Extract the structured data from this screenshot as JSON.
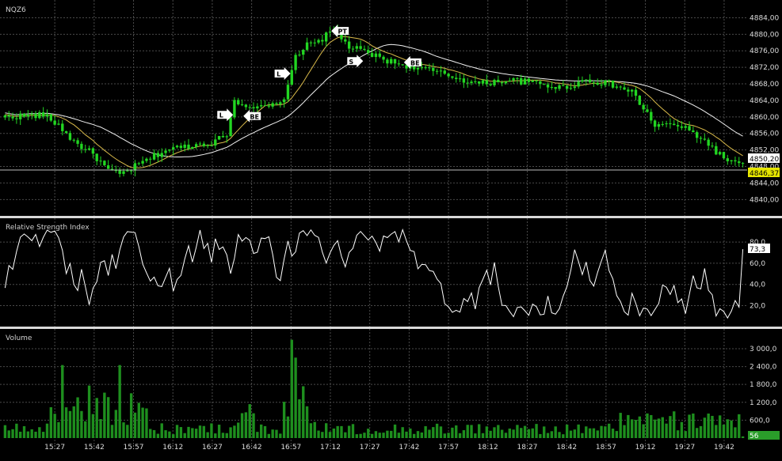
{
  "colors": {
    "background": "#000000",
    "grid": "#4a4a4a",
    "candle": "#22d622",
    "ma_fast": "#d8b94a",
    "ma_slow": "#f2f2f2",
    "rsi": "#ffffff",
    "volume": "#1e8f1e",
    "separator": "#d9d9d9",
    "price_tag_bg": "#ffffff",
    "last_tag_bg": "#e6e600"
  },
  "chart_data": [
    {
      "type": "candlestick",
      "title": "NQZ6",
      "x_labels": [
        "15:27",
        "15:42",
        "15:57",
        "16:12",
        "16:27",
        "16:42",
        "16:57",
        "17:12",
        "17:27",
        "17:42",
        "17:57",
        "18:12",
        "18:27",
        "18:42",
        "18:57",
        "19:12",
        "19:27",
        "19:42"
      ],
      "y_ticks": [
        "4884,00",
        "4880,00",
        "4876,00",
        "4872,00",
        "4868,00",
        "4864,00",
        "4860,00",
        "4856,00",
        "4852,00",
        "4848,00",
        "4844,00",
        "4840,00"
      ],
      "ylim": [
        4837,
        4886
      ],
      "grid": true,
      "anchors": [
        {
          "x": 0,
          "y": 4860
        },
        {
          "x": 10,
          "y": 4860.5
        },
        {
          "x": 14,
          "y": 4858
        },
        {
          "x": 18,
          "y": 4854
        },
        {
          "x": 23,
          "y": 4851
        },
        {
          "x": 27,
          "y": 4847
        },
        {
          "x": 30,
          "y": 4846
        },
        {
          "x": 36,
          "y": 4849
        },
        {
          "x": 42,
          "y": 4852
        },
        {
          "x": 48,
          "y": 4853
        },
        {
          "x": 55,
          "y": 4854
        },
        {
          "x": 58,
          "y": 4856
        },
        {
          "x": 60,
          "y": 4864
        },
        {
          "x": 66,
          "y": 4862
        },
        {
          "x": 72,
          "y": 4863
        },
        {
          "x": 74,
          "y": 4867
        },
        {
          "x": 76,
          "y": 4875
        },
        {
          "x": 80,
          "y": 4878
        },
        {
          "x": 83,
          "y": 4879
        },
        {
          "x": 86,
          "y": 4881
        },
        {
          "x": 90,
          "y": 4877
        },
        {
          "x": 96,
          "y": 4875
        },
        {
          "x": 102,
          "y": 4873
        },
        {
          "x": 108,
          "y": 4872
        },
        {
          "x": 116,
          "y": 4870
        },
        {
          "x": 124,
          "y": 4868
        },
        {
          "x": 132,
          "y": 4869
        },
        {
          "x": 140,
          "y": 4868
        },
        {
          "x": 146,
          "y": 4867
        },
        {
          "x": 152,
          "y": 4869
        },
        {
          "x": 158,
          "y": 4868
        },
        {
          "x": 164,
          "y": 4866
        },
        {
          "x": 170,
          "y": 4858
        },
        {
          "x": 176,
          "y": 4858
        },
        {
          "x": 182,
          "y": 4855
        },
        {
          "x": 188,
          "y": 4850
        },
        {
          "x": 193,
          "y": 4848
        }
      ],
      "last_prices": [
        "4850,20",
        "4846,37"
      ],
      "trade_markers": [
        {
          "label": "L",
          "x": 58,
          "price": 4860.5,
          "dir": "right"
        },
        {
          "label": "BE",
          "x": 64,
          "price": 4860.2,
          "dir": "left"
        },
        {
          "label": "L",
          "x": 73,
          "price": 4870.5,
          "dir": "right"
        },
        {
          "label": "PT",
          "x": 87,
          "price": 4880.8,
          "dir": "left"
        },
        {
          "label": "S",
          "x": 92,
          "price": 4873.5,
          "dir": "right"
        },
        {
          "label": "BE",
          "x": 106,
          "price": 4873.2,
          "dir": "left"
        }
      ]
    },
    {
      "type": "line",
      "title": "Relative Strength Index",
      "y_ticks": [
        "80,0",
        "60,0",
        "40,0",
        "20,0"
      ],
      "ylim": [
        4,
        98
      ],
      "grid": true,
      "last_value": "73,3"
    },
    {
      "type": "bar",
      "title": "Volume",
      "y_ticks": [
        "3 000,0",
        "2 400,0",
        "1 800,0",
        "1 200,0",
        "600,0"
      ],
      "ylim": [
        0,
        3450
      ],
      "grid": true,
      "last_value": "56"
    }
  ]
}
